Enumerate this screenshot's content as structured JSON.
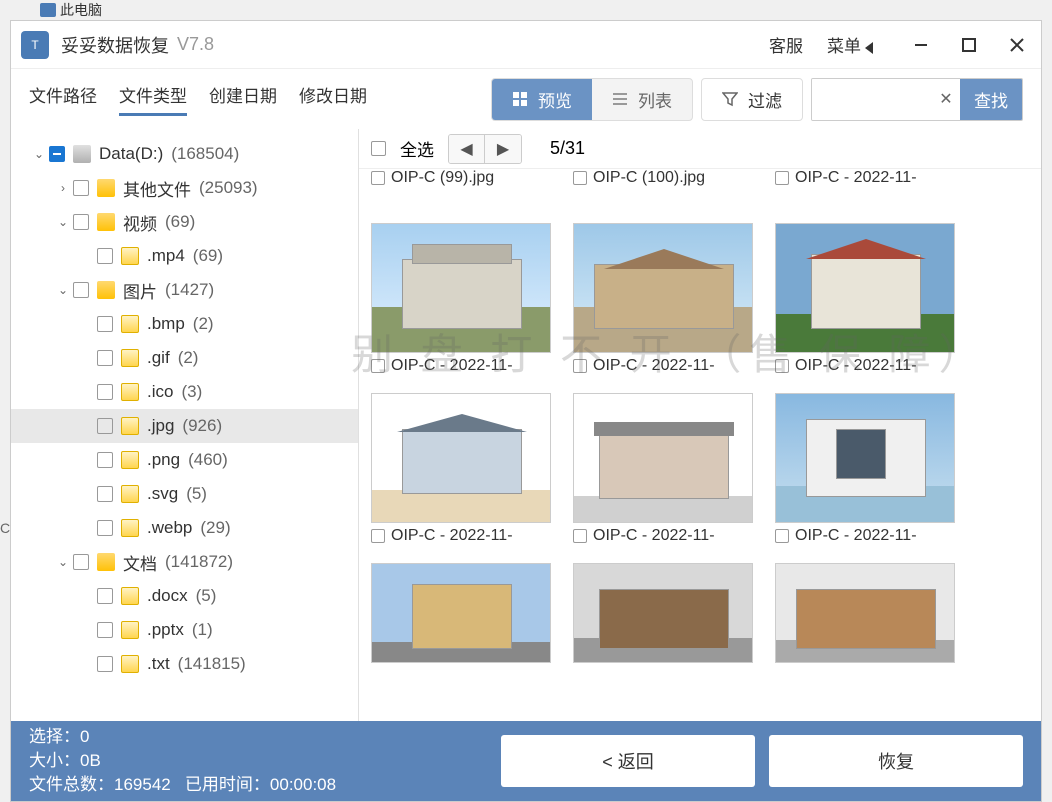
{
  "app": {
    "title": "妥妥数据恢复",
    "version": "V7.8"
  },
  "titlebar": {
    "service": "客服",
    "menu": "菜单"
  },
  "tabs": {
    "path": "文件路径",
    "type": "文件类型",
    "created": "创建日期",
    "modified": "修改日期"
  },
  "toolbar": {
    "preview": "预览",
    "list": "列表",
    "filter": "过滤",
    "search": "查找"
  },
  "tree": {
    "root": {
      "name": "Data(D:)",
      "count": "(168504)"
    },
    "other": {
      "name": "其他文件",
      "count": "(25093)"
    },
    "video": {
      "name": "视频",
      "count": "(69)"
    },
    "mp4": {
      "name": ".mp4",
      "count": "(69)"
    },
    "image": {
      "name": "图片",
      "count": "(1427)"
    },
    "bmp": {
      "name": ".bmp",
      "count": "(2)"
    },
    "gif": {
      "name": ".gif",
      "count": "(2)"
    },
    "ico": {
      "name": ".ico",
      "count": "(3)"
    },
    "jpg": {
      "name": ".jpg",
      "count": "(926)"
    },
    "png": {
      "name": ".png",
      "count": "(460)"
    },
    "svg": {
      "name": ".svg",
      "count": "(5)"
    },
    "webp": {
      "name": ".webp",
      "count": "(29)"
    },
    "doc": {
      "name": "文档",
      "count": "(141872)"
    },
    "docx": {
      "name": ".docx",
      "count": "(5)"
    },
    "pptx": {
      "name": ".pptx",
      "count": "(1)"
    },
    "txt": {
      "name": ".txt",
      "count": "(141815)"
    }
  },
  "main": {
    "selectAll": "全选",
    "pageInfo": "5/31"
  },
  "files": {
    "f0": "OIP-C (99).jpg",
    "f1": "OIP-C (100).jpg",
    "f2": "OIP-C - 2022-11-",
    "f3": "OIP-C - 2022-11-",
    "f4": "OIP-C - 2022-11-",
    "f5": "OIP-C - 2022-11-",
    "f6": "OIP-C - 2022-11-",
    "f7": "OIP-C - 2022-11-",
    "f8": "OIP-C - 2022-11-"
  },
  "watermark": "别  盘 打 不 开 （售    保 障）",
  "footer": {
    "selected_lbl": "选择：",
    "selected_val": "0",
    "size_lbl": "大小：",
    "size_val": "0B",
    "total_lbl": "文件总数：",
    "total_val": "169542",
    "time_lbl": "已用时间：",
    "time_val": "00:00:08",
    "back": "< 返回",
    "recover": "恢复"
  },
  "peek": "此电脑"
}
